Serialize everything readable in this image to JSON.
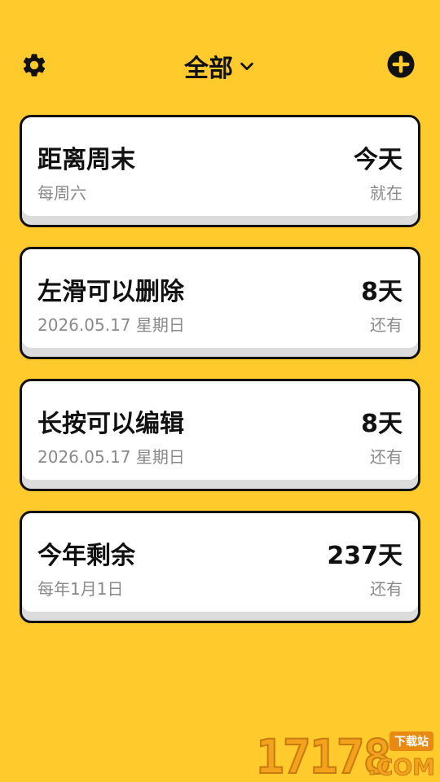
{
  "header": {
    "title": "全部",
    "settings_icon": "gear-icon",
    "dropdown_icon": "chevron-down-icon",
    "add_icon": "plus-circle-icon"
  },
  "events": [
    {
      "name": "距离周末",
      "sub": "每周六",
      "days": "今天",
      "note": "就在"
    },
    {
      "name": "左滑可以删除",
      "sub": "2026.05.17 星期日",
      "days": "8天",
      "note": "还有"
    },
    {
      "name": "长按可以编辑",
      "sub": "2026.05.17 星期日",
      "days": "8天",
      "note": "还有"
    },
    {
      "name": "今年剩余",
      "sub": "每年1月1日",
      "days": "237天",
      "note": "还有"
    }
  ],
  "watermark": {
    "digits": "17178",
    "com": ".COM",
    "badge": "下载站"
  },
  "colors": {
    "background": "#FFCA2C",
    "card": "#FFFFFF",
    "border": "#111111",
    "muted": "#8A8A8A"
  }
}
